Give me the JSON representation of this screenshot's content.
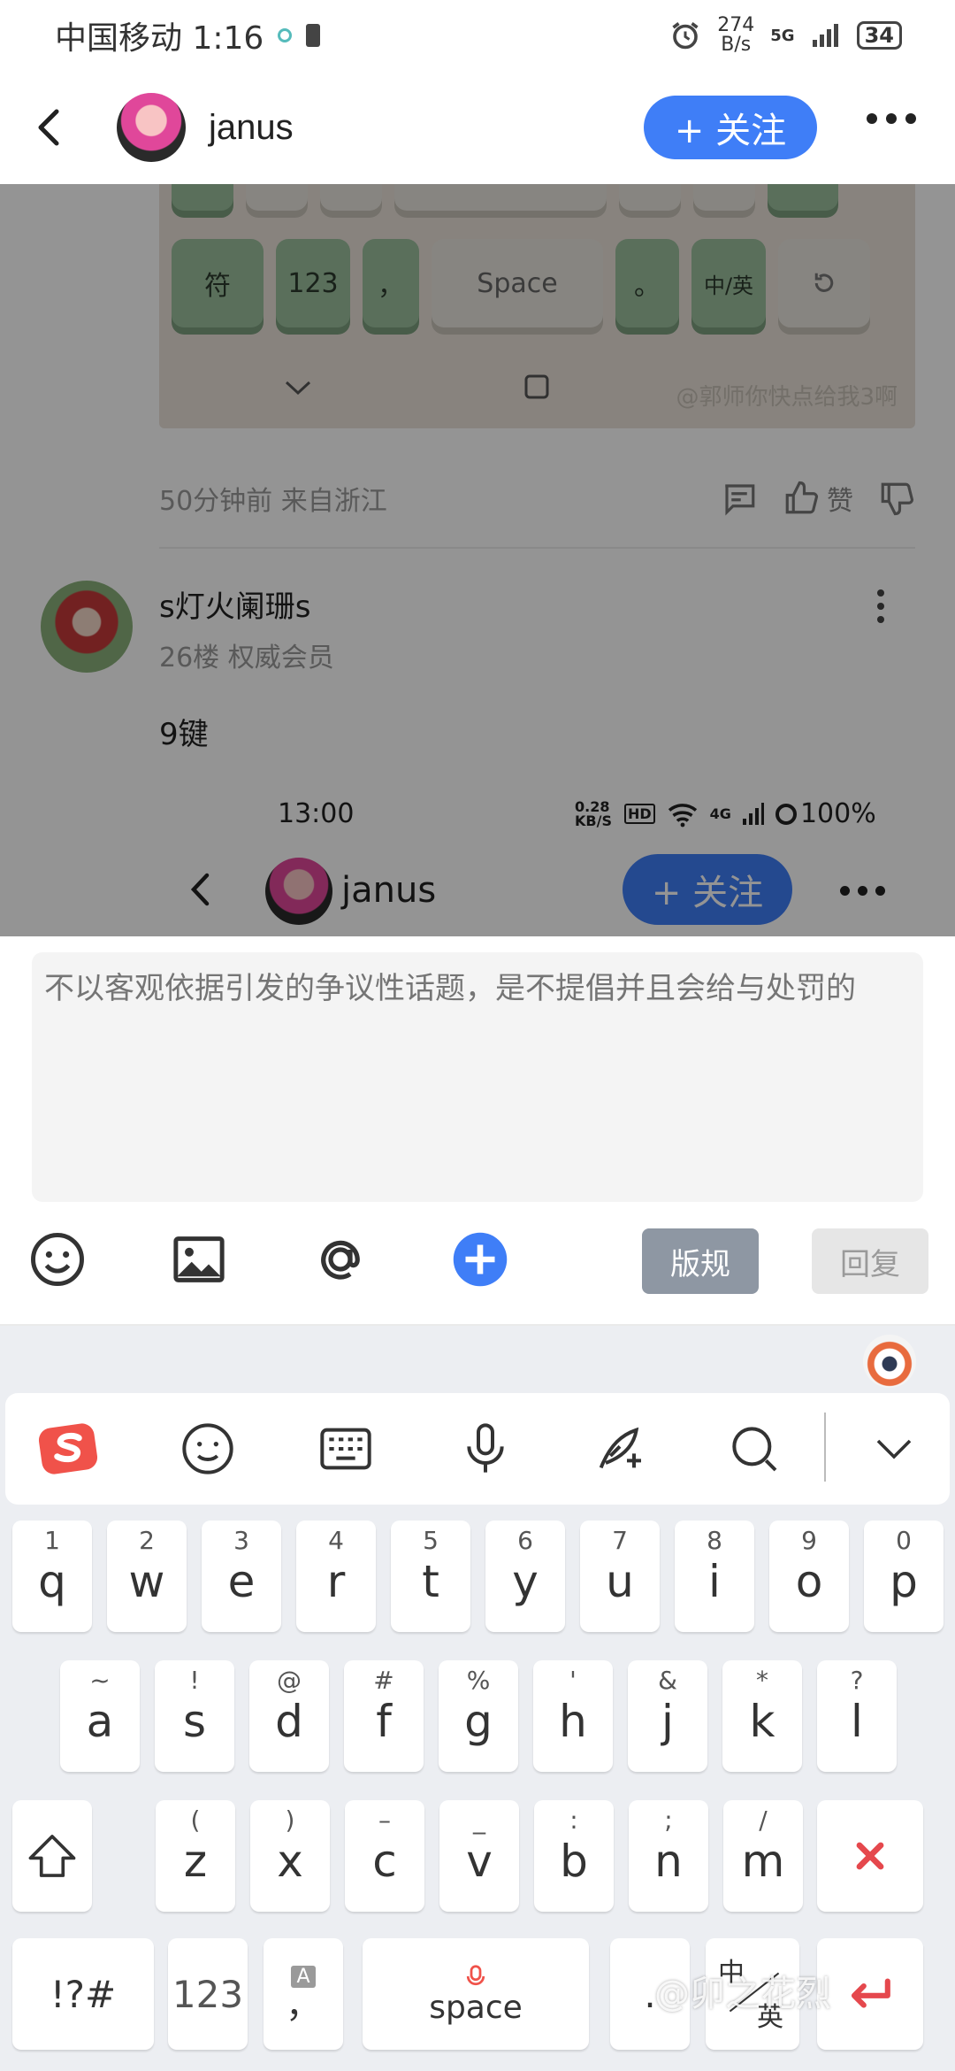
{
  "status_bar": {
    "carrier_time": "中国移动 1:16",
    "net_speed_value": "274",
    "net_speed_unit": "B/s",
    "network": "5G",
    "battery": "34"
  },
  "header": {
    "username": "janus",
    "follow_label": "+ 关注"
  },
  "post_image": {
    "keys": {
      "symbols": "符",
      "numbers": "123",
      "comma": "，",
      "space": "Space",
      "period": "。",
      "lang": "中/英"
    },
    "watermark": "@郭师你快点给我3啊"
  },
  "post_meta": {
    "time_location": "50分钟前 来自浙江",
    "like_label": "赞"
  },
  "comment": {
    "name": "s灯火阑珊s",
    "sub": "26楼 权威会员",
    "body": "9键"
  },
  "embedded_screenshot": {
    "time": "13:00",
    "speed": "0.28 KB/S",
    "hd": "HD",
    "network": "4G",
    "battery": "100%",
    "username": "janus",
    "follow_label": "+ 关注"
  },
  "reply": {
    "placeholder": "不以客观依据引发的争议性话题，是不提倡并且会给与处罚的",
    "rules_label": "版规",
    "reply_label": "回复"
  },
  "keyboard": {
    "row1": [
      {
        "sub": "1",
        "main": "q"
      },
      {
        "sub": "2",
        "main": "w"
      },
      {
        "sub": "3",
        "main": "e"
      },
      {
        "sub": "4",
        "main": "r"
      },
      {
        "sub": "5",
        "main": "t"
      },
      {
        "sub": "6",
        "main": "y"
      },
      {
        "sub": "7",
        "main": "u"
      },
      {
        "sub": "8",
        "main": "i"
      },
      {
        "sub": "9",
        "main": "o"
      },
      {
        "sub": "0",
        "main": "p"
      }
    ],
    "row2": [
      {
        "sub": "~",
        "main": "a"
      },
      {
        "sub": "!",
        "main": "s"
      },
      {
        "sub": "@",
        "main": "d"
      },
      {
        "sub": "#",
        "main": "f"
      },
      {
        "sub": "%",
        "main": "g"
      },
      {
        "sub": "'",
        "main": "h"
      },
      {
        "sub": "&",
        "main": "j"
      },
      {
        "sub": "*",
        "main": "k"
      },
      {
        "sub": "?",
        "main": "l"
      }
    ],
    "row3": [
      {
        "sub": "(",
        "main": "z"
      },
      {
        "sub": ")",
        "main": "x"
      },
      {
        "sub": "–",
        "main": "c"
      },
      {
        "sub": "_",
        "main": "v"
      },
      {
        "sub": ":",
        "main": "b"
      },
      {
        "sub": ";",
        "main": "n"
      },
      {
        "sub": "/",
        "main": "m"
      }
    ],
    "symbols_key": "!?#",
    "numbers_key": "123",
    "comma_key": "，",
    "comma_sub": "A",
    "space_key": "space",
    "period_key": ".",
    "lang_key_top": "中",
    "lang_key_bottom": "英",
    "watermark": "@卯之花烈"
  },
  "colors": {
    "accent": "#3f7ef7",
    "rules_button": "#8e97a3",
    "delete": "#e5484d",
    "ime_logo": "#f0524a"
  }
}
